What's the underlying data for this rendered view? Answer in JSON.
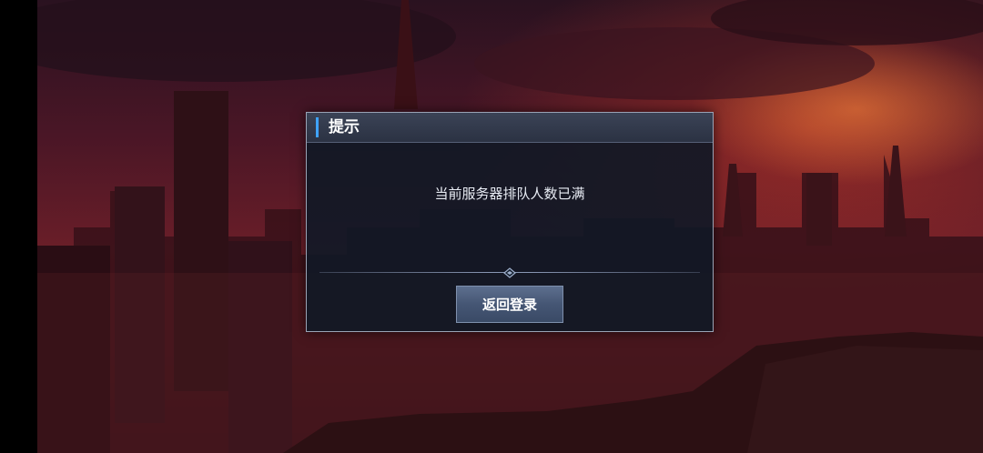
{
  "dialog": {
    "title": "提示",
    "message": "当前服务器排队人数已满",
    "return_button_label": "返回登录"
  },
  "colors": {
    "accent": "#3fa3ff",
    "panel": "#101826",
    "button": "#455674"
  }
}
